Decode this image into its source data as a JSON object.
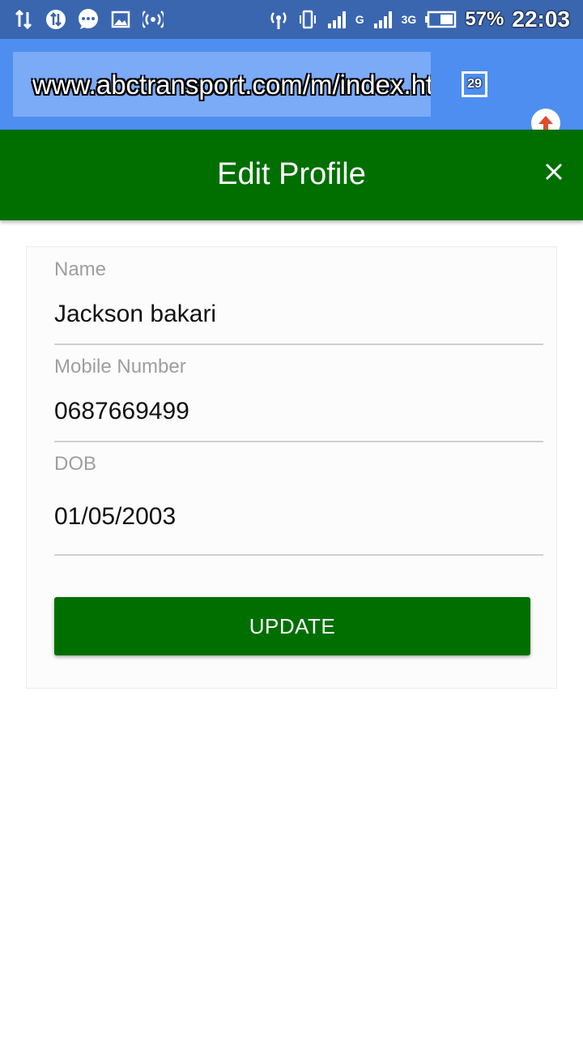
{
  "status_bar": {
    "left_icons": [
      "data-transfer-icon",
      "data-saver-icon",
      "messenger-icon",
      "gallery-icon",
      "hotspot-icon"
    ],
    "right_icons": [
      "wireless-icon",
      "vibrate-icon",
      "signal-icon",
      "signal-icon"
    ],
    "network_g": "G",
    "network_3g": "3G",
    "battery_percent": "57%",
    "time": "22:03"
  },
  "browser": {
    "url": "www.abctransport.com/m/index.html",
    "tab_count": "29"
  },
  "app_bar": {
    "title": "Edit Profile"
  },
  "form": {
    "fields": [
      {
        "label": "Name",
        "value": "Jackson bakari"
      },
      {
        "label": "Mobile Number",
        "value": "0687669499"
      },
      {
        "label": "DOB",
        "value": "01/05/2003"
      }
    ],
    "update_label": "UPDATE"
  },
  "colors": {
    "status_bar": "#3a66b0",
    "browser_bar": "#4d8ef0",
    "app_bar": "#006f00",
    "button": "#006f00"
  }
}
